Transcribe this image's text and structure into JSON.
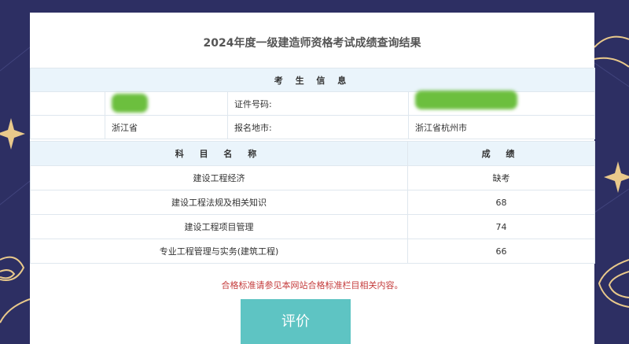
{
  "page": {
    "title": "2024年度一级建造师资格考试成绩查询结果"
  },
  "candidate": {
    "section_header": "考 生 信 息",
    "id_label": "证件号码:",
    "province": "浙江省",
    "city_label": "报名地市:",
    "city_value": "浙江省杭州市"
  },
  "scores": {
    "col_subject": "科 目 名 称",
    "col_score": "成 绩",
    "rows": [
      {
        "subject": "建设工程经济",
        "score": "缺考"
      },
      {
        "subject": "建设工程法规及相关知识",
        "score": "68"
      },
      {
        "subject": "建设工程项目管理",
        "score": "74"
      },
      {
        "subject": "专业工程管理与实务(建筑工程)",
        "score": "66"
      }
    ]
  },
  "footer": {
    "note": "合格标准请参见本网站合格标准栏目相关内容。",
    "rate_button": "评价"
  },
  "colors": {
    "background": "#2d2f63",
    "header_bg": "#eaf4fb",
    "note_red": "#c43b3b",
    "button_teal": "#5ec4c3",
    "redaction_green": "#6cbf3e"
  },
  "icons": [
    "sparkle-icon",
    "cloud-swirl-decoration"
  ]
}
